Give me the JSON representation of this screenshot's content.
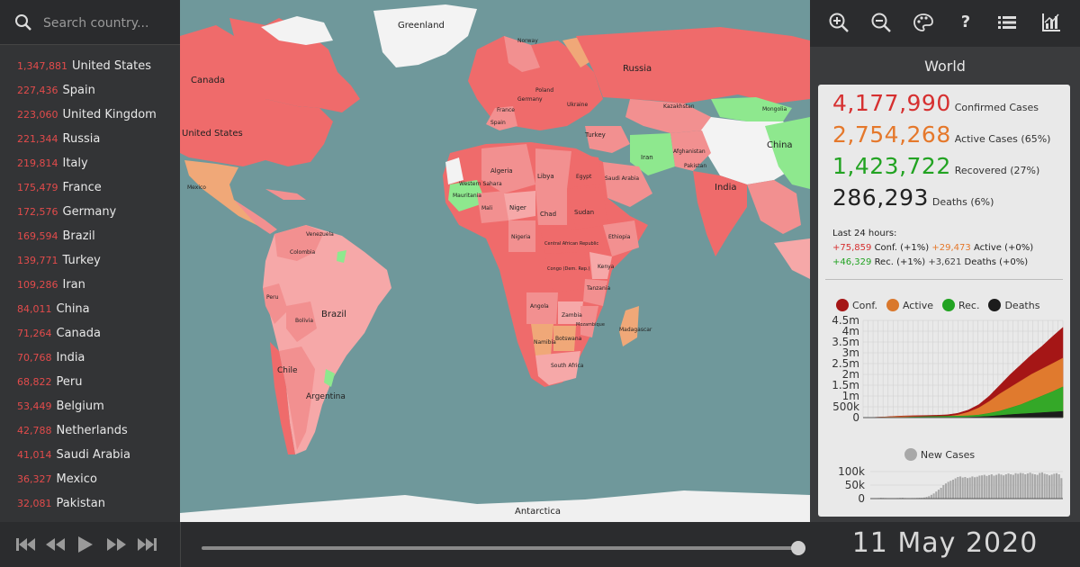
{
  "search": {
    "placeholder": "Search country..."
  },
  "countries": [
    {
      "count": "1,347,881",
      "name": "United States"
    },
    {
      "count": "227,436",
      "name": "Spain"
    },
    {
      "count": "223,060",
      "name": "United Kingdom"
    },
    {
      "count": "221,344",
      "name": "Russia"
    },
    {
      "count": "219,814",
      "name": "Italy"
    },
    {
      "count": "175,479",
      "name": "France"
    },
    {
      "count": "172,576",
      "name": "Germany"
    },
    {
      "count": "169,594",
      "name": "Brazil"
    },
    {
      "count": "139,771",
      "name": "Turkey"
    },
    {
      "count": "109,286",
      "name": "Iran"
    },
    {
      "count": "84,011",
      "name": "China"
    },
    {
      "count": "71,264",
      "name": "Canada"
    },
    {
      "count": "70,768",
      "name": "India"
    },
    {
      "count": "68,822",
      "name": "Peru"
    },
    {
      "count": "53,449",
      "name": "Belgium"
    },
    {
      "count": "42,788",
      "name": "Netherlands"
    },
    {
      "count": "41,014",
      "name": "Saudi Arabia"
    },
    {
      "count": "36,327",
      "name": "Mexico"
    },
    {
      "count": "32,081",
      "name": "Pakistan"
    }
  ],
  "map": {
    "labels": {
      "greenland": "Greenland",
      "canada": "Canada",
      "united_states": "United States",
      "mexico": "Mexico",
      "brazil": "Brazil",
      "argentina": "Argentina",
      "chile": "Chile",
      "peru": "Peru",
      "bolivia": "Bolivia",
      "colombia": "Colombia",
      "venezuela": "Venezuela",
      "russia": "Russia",
      "kazakhstan": "Kazakhstan",
      "mongolia": "Mongolia",
      "china": "China",
      "india": "India",
      "iran": "Iran",
      "turkey": "Turkey",
      "algeria": "Algeria",
      "libya": "Libya",
      "egypt": "Egypt",
      "sudan": "Sudan",
      "chad": "Chad",
      "niger": "Niger",
      "mali": "Mali",
      "mauritania": "Mauritania",
      "nigeria": "Nigeria",
      "ethiopia": "Ethiopia",
      "angola": "Angola",
      "zambia": "Zambia",
      "namibia": "Namibia",
      "botswana": "Botswana",
      "south_africa": "South Africa",
      "madagascar": "Madagascar",
      "antarctica": "Antarctica",
      "afghanistan": "Afghanistan",
      "pakistan": "Pakistan",
      "saudi_arabia": "Saudi Arabia",
      "norway": "Norway",
      "ukraine": "Ukraine",
      "poland": "Poland",
      "germany": "Germany",
      "france": "France",
      "spain": "Spain",
      "western_sahara": "Western Sahara",
      "tanzania": "Tanzania",
      "kenya": "Kenya",
      "mozambique": "Mozambique",
      "drc": "Congo (Dem. Rep.)",
      "car": "Central African Republic"
    },
    "colors": {
      "ocean": "#6f989b",
      "high": "#ef6b6b",
      "mid": "#f29090",
      "low": "#f6a8a8",
      "orange": "#f0a878",
      "green": "#8ee88e",
      "white": "#f3f3f3",
      "ice": "#f0f0f0"
    }
  },
  "toolbar": {
    "icons": [
      "zoom-in-icon",
      "zoom-out-icon",
      "palette-icon",
      "help-icon",
      "list-icon",
      "chart-icon"
    ],
    "help_glyph": "?"
  },
  "panel": {
    "region": "World",
    "confirmed": {
      "value": "4,177,990",
      "label": "Confirmed Cases",
      "color": "#d63030"
    },
    "active": {
      "value": "2,754,268",
      "label": "Active Cases (65%)",
      "color": "#e5782b"
    },
    "recovered": {
      "value": "1,423,722",
      "label": "Recovered (27%)",
      "color": "#22a322"
    },
    "deaths": {
      "value": "286,293",
      "label": "Deaths (6%)",
      "color": "#222222"
    },
    "last24": {
      "title": "Last 24 hours:",
      "conf_delta": "+75,859",
      "conf_label": "Conf. (+1%)",
      "active_delta": "+29,473",
      "active_label": "Active (+0%)",
      "rec_delta": "+46,329",
      "rec_label": "Rec. (+1%)",
      "deaths_delta": "+3,621",
      "deaths_label": "Deaths (+0%)"
    },
    "legend": [
      {
        "label": "Conf.",
        "color": "#a51616"
      },
      {
        "label": "Active",
        "color": "#d9782d"
      },
      {
        "label": "Rec.",
        "color": "#22a322"
      },
      {
        "label": "Deaths",
        "color": "#1c1c1c"
      }
    ],
    "new_cases_legend": {
      "label": "New Cases",
      "color": "#a8a8a8"
    }
  },
  "chart_data": [
    {
      "type": "area",
      "title": "",
      "ylim": [
        0,
        4500000
      ],
      "yticks": [
        "4.5m",
        "4m",
        "3.5m",
        "3m",
        "2.5m",
        "2m",
        "1.5m",
        "1m",
        "500k",
        "0"
      ],
      "x": [
        1,
        2,
        3,
        4,
        5,
        6,
        7,
        8,
        9,
        10,
        11,
        12,
        13,
        14,
        15,
        16,
        17,
        18,
        19,
        20
      ],
      "series": [
        {
          "name": "Conf.",
          "values": [
            0,
            10000,
            30000,
            60000,
            80000,
            90000,
            100000,
            110000,
            130000,
            200000,
            350000,
            600000,
            1000000,
            1500000,
            2000000,
            2450000,
            2900000,
            3300000,
            3750000,
            4177990
          ]
        },
        {
          "name": "Active",
          "values": [
            0,
            9000,
            25000,
            45000,
            50000,
            45000,
            40000,
            40000,
            50000,
            120000,
            250000,
            450000,
            750000,
            1100000,
            1400000,
            1700000,
            2000000,
            2250000,
            2500000,
            2754268
          ]
        },
        {
          "name": "Rec.",
          "values": [
            0,
            200,
            1000,
            5000,
            15000,
            30000,
            45000,
            55000,
            65000,
            70000,
            85000,
            120000,
            200000,
            300000,
            450000,
            600000,
            800000,
            1000000,
            1200000,
            1423722
          ]
        },
        {
          "name": "Deaths",
          "values": [
            0,
            100,
            500,
            1500,
            2500,
            3000,
            3500,
            4000,
            5000,
            9000,
            17000,
            35000,
            60000,
            100000,
            140000,
            170000,
            200000,
            230000,
            260000,
            286293
          ]
        }
      ]
    },
    {
      "type": "bar",
      "title": "",
      "ylim": [
        0,
        100000
      ],
      "yticks": [
        "100k",
        "50k",
        "0"
      ],
      "series": [
        {
          "name": "New Cases",
          "values": [
            0,
            500,
            1000,
            2000,
            3000,
            2500,
            2000,
            1500,
            1000,
            1000,
            1500,
            2000,
            2500,
            3000,
            2000,
            1500,
            1500,
            2000,
            2000,
            2500,
            3000,
            3000,
            4000,
            6000,
            9000,
            14000,
            19000,
            26000,
            33000,
            40000,
            50000,
            56000,
            62000,
            66000,
            70000,
            75000,
            80000,
            82000,
            78000,
            80000,
            76000,
            78000,
            82000,
            79000,
            81000,
            85000,
            86000,
            88000,
            84000,
            87000,
            90000,
            85000,
            88000,
            92000,
            89000,
            86000,
            90000,
            93000,
            90000,
            88000,
            94000,
            92000,
            95000,
            94000,
            90000,
            93000,
            96000,
            92000,
            90000,
            88000,
            95000,
            97000,
            92000,
            90000,
            86000,
            89000,
            92000,
            94000,
            90000,
            75859
          ]
        }
      ]
    }
  ],
  "timeline": {
    "position": 1.0
  },
  "date": "11 May 2020"
}
